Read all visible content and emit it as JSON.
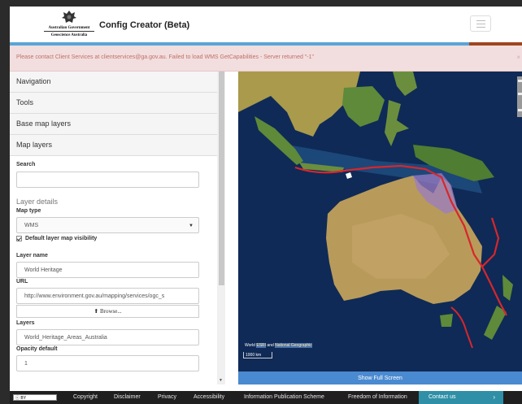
{
  "header": {
    "gov_line": "Australian Government",
    "agency_line": "Geoscience Australia",
    "app_title": "Config Creator (Beta)"
  },
  "alert": {
    "message": "Please contact Client Services at clientservices@ga.gov.au. Failed to load WMS GetCapabilities - Server returned \"-1\"",
    "close": "×"
  },
  "sidebar": {
    "sections": [
      "Navigation",
      "Tools",
      "Base map layers",
      "Map layers"
    ],
    "search_label": "Search",
    "search_value": "",
    "layer_details_title": "Layer details",
    "map_type_label": "Map type",
    "map_type_value": "WMS",
    "visibility_label": "Default layer map visibility",
    "visibility_checked": true,
    "layer_name_label": "Layer name",
    "layer_name_value": "World Heritage",
    "url_label": "URL",
    "url_value": "http://www.environment.gov.au/mapping/services/ogc_s",
    "browse_label": "Browse...",
    "layers_label": "Layers",
    "layers_value": "World_Heritage_Areas_Australia",
    "opacity_label": "Opacity default",
    "opacity_value": "1"
  },
  "map": {
    "attribution_prefix": "World ",
    "attribution_link1": "ESRI",
    "attribution_mid": " and ",
    "attribution_link2": "National Geographic",
    "scale_label": "1000 km",
    "fullscreen_label": "Show Full Screen",
    "colors": {
      "ocean": "#0f2a56",
      "land": "#b8a85a",
      "overlay": "#9b7cc4",
      "line": "#d8262c"
    }
  },
  "footer": {
    "license_label": "BY",
    "links": [
      "Copyright",
      "Disclaimer",
      "Privacy",
      "Accessibility",
      "Information Publication Scheme",
      "Freedom of Information"
    ],
    "contact_label": "Contact us",
    "contact_arrow": "›"
  }
}
